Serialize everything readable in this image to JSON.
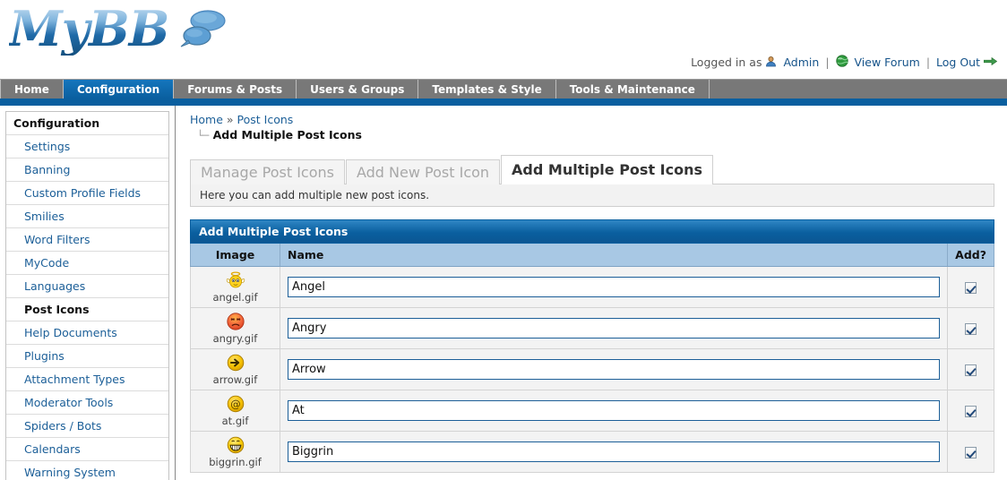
{
  "brand": {
    "name": "MyBB",
    "bubble_icon": "speech-bubble-icon"
  },
  "userbar": {
    "logged_in_label": "Logged in as",
    "admin_label": "Admin",
    "admin_icon": "user-icon",
    "view_forum_label": "View Forum",
    "view_forum_icon": "globe-icon",
    "logout_label": "Log Out",
    "logout_icon": "arrow-right-icon",
    "separator": "|"
  },
  "nav": {
    "items": [
      {
        "label": "Home",
        "active": false
      },
      {
        "label": "Configuration",
        "active": true
      },
      {
        "label": "Forums & Posts",
        "active": false
      },
      {
        "label": "Users & Groups",
        "active": false
      },
      {
        "label": "Templates & Style",
        "active": false
      },
      {
        "label": "Tools & Maintenance",
        "active": false
      }
    ]
  },
  "sidebar": {
    "title": "Configuration",
    "items": [
      {
        "label": "Settings",
        "active": false
      },
      {
        "label": "Banning",
        "active": false
      },
      {
        "label": "Custom Profile Fields",
        "active": false
      },
      {
        "label": "Smilies",
        "active": false
      },
      {
        "label": "Word Filters",
        "active": false
      },
      {
        "label": "MyCode",
        "active": false
      },
      {
        "label": "Languages",
        "active": false
      },
      {
        "label": "Post Icons",
        "active": true
      },
      {
        "label": "Help Documents",
        "active": false
      },
      {
        "label": "Plugins",
        "active": false
      },
      {
        "label": "Attachment Types",
        "active": false
      },
      {
        "label": "Moderator Tools",
        "active": false
      },
      {
        "label": "Spiders / Bots",
        "active": false
      },
      {
        "label": "Calendars",
        "active": false
      },
      {
        "label": "Warning System",
        "active": false
      }
    ]
  },
  "breadcrumb": {
    "home": "Home",
    "separator": "»",
    "section": "Post Icons",
    "branch_glyph": "└─",
    "current": "Add Multiple Post Icons"
  },
  "tabs": [
    {
      "label": "Manage Post Icons",
      "active": false
    },
    {
      "label": "Add New Post Icon",
      "active": false
    },
    {
      "label": "Add Multiple Post Icons",
      "active": true
    }
  ],
  "tab_description": "Here you can add multiple new post icons.",
  "panel": {
    "title": "Add Multiple Post Icons",
    "columns": {
      "image": "Image",
      "name": "Name",
      "add": "Add?"
    },
    "rows": [
      {
        "file": "angel.gif",
        "name": "Angel",
        "icon": "angel-smiley-icon",
        "checked": true
      },
      {
        "file": "angry.gif",
        "name": "Angry",
        "icon": "angry-smiley-icon",
        "checked": true
      },
      {
        "file": "arrow.gif",
        "name": "Arrow",
        "icon": "arrow-smiley-icon",
        "checked": true
      },
      {
        "file": "at.gif",
        "name": "At",
        "icon": "at-smiley-icon",
        "checked": true
      },
      {
        "file": "biggrin.gif",
        "name": "Biggrin",
        "icon": "biggrin-smiley-icon",
        "checked": true
      }
    ]
  },
  "colors": {
    "nav_active": "#0a5f9f",
    "nav_bg": "#787878",
    "panel_title": "#0a5f9f",
    "table_header": "#a8c8e4",
    "link": "#1c5f98",
    "input_border": "#1c5f98"
  }
}
